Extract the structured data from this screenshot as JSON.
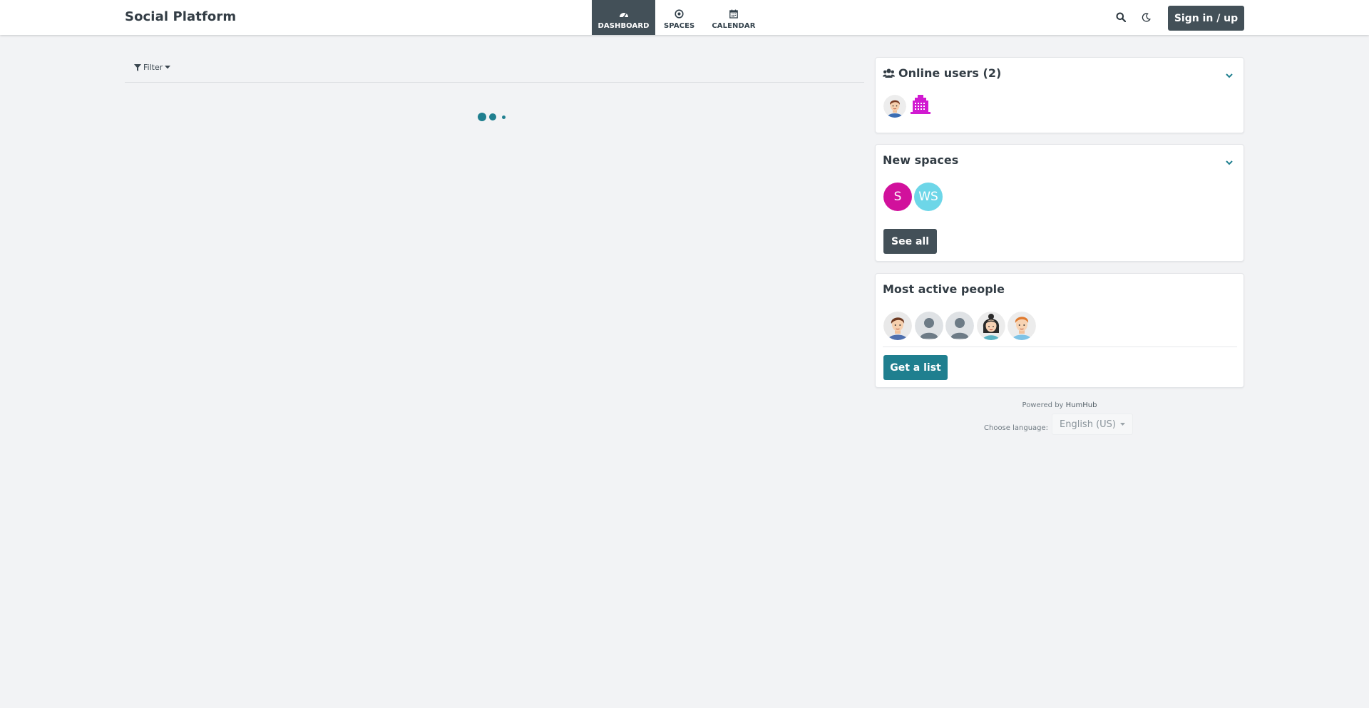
{
  "app": {
    "brand": "Social Platform"
  },
  "nav": {
    "items": [
      {
        "label": "DASHBOARD",
        "icon": "dashboard-icon",
        "active": true
      },
      {
        "label": "SPACES",
        "icon": "spaces-icon",
        "active": false
      },
      {
        "label": "CALENDAR",
        "icon": "calendar-icon",
        "active": false
      }
    ]
  },
  "header": {
    "signin_label": "Sign in / up",
    "search_icon": "search-icon",
    "theme_icon": "moon-icon"
  },
  "stream": {
    "filter_label": "Filter"
  },
  "panels": {
    "online_users": {
      "title": "Online users (2)",
      "icon": "users-icon",
      "count": 2
    },
    "new_spaces": {
      "title": "New spaces",
      "spaces": [
        {
          "initials": "S",
          "color": "#d1119c"
        },
        {
          "initials": "WS",
          "color": "#6dd6e8"
        }
      ],
      "see_all_label": "See all"
    },
    "most_active": {
      "title": "Most active people",
      "button_label": "Get a list"
    }
  },
  "footer": {
    "powered_by": "Powered by",
    "powered_link": "HumHub",
    "choose_language": "Choose language:",
    "language": "English (US)"
  },
  "colors": {
    "accent": "#1f7f8f",
    "dark": "#435058",
    "background": "#f2f3f5"
  }
}
